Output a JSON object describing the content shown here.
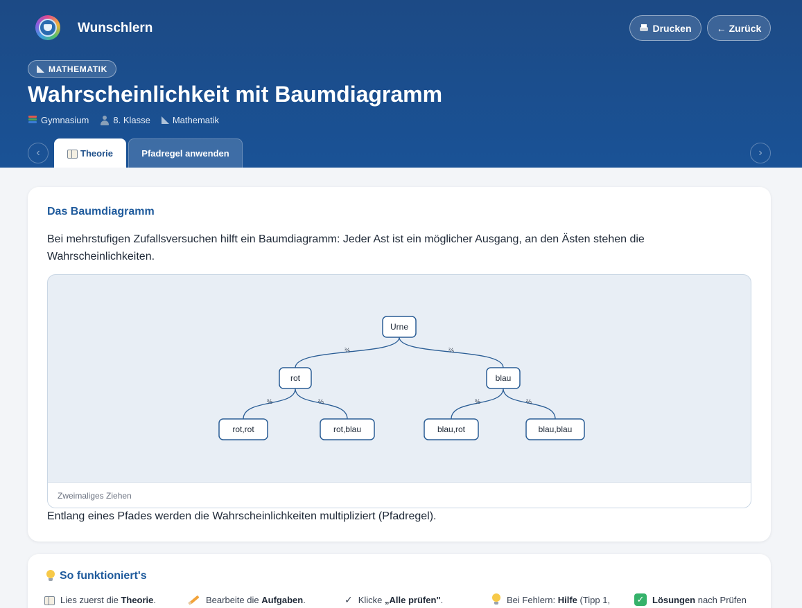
{
  "app": {
    "name": "Wunschlern"
  },
  "header": {
    "print_label": "Drucken",
    "back_label": "← Zurück",
    "subject_pill": "MATHEMATIK",
    "title": "Wahrscheinlichkeit mit Baumdiagramm",
    "meta": {
      "school": "Gymnasium",
      "grade": "8. Klasse",
      "subject": "Mathematik"
    },
    "nav_prev": "‹",
    "nav_next": "›"
  },
  "tabs": [
    {
      "label": "Theorie",
      "active": true
    },
    {
      "label": "Pfadregel anwenden",
      "active": false
    }
  ],
  "theory": {
    "heading": "Das Baumdiagramm",
    "intro": "Bei mehrstufigen Zufallsversuchen hilft ein Baumdiagramm: Jeder Ast ist ein möglicher Ausgang, an den Ästen stehen die Wahrscheinlichkeiten.",
    "diagram": {
      "root": "Urne",
      "level1": [
        {
          "label": "rot",
          "prob": "⅗"
        },
        {
          "label": "blau",
          "prob": "⅖"
        }
      ],
      "level2": [
        {
          "label": "rot,rot",
          "prob": "⅗"
        },
        {
          "label": "rot,blau",
          "prob": "⅖"
        },
        {
          "label": "blau,rot",
          "prob": "⅗"
        },
        {
          "label": "blau,blau",
          "prob": "⅖"
        }
      ],
      "caption": "Zweimaliges Ziehen"
    },
    "outro": "Entlang eines Pfades werden die Wahrscheinlichkeiten multipliziert (Pfadregel)."
  },
  "howto": {
    "heading": "So funktioniert's",
    "steps": [
      {
        "pre": "Lies zuerst die ",
        "bold": "Theorie",
        "post": "."
      },
      {
        "pre": "Bearbeite die ",
        "bold": "Aufgaben",
        "post": "."
      },
      {
        "pre": "Klicke ",
        "bold": "„Alle prüfen\"",
        "post": "."
      },
      {
        "pre": "Bei Fehlern: ",
        "bold": "Hilfe",
        "post": " (Tipp 1,"
      },
      {
        "pre": "",
        "bold": "Lösungen",
        "post": " nach Prüfen"
      }
    ]
  },
  "colors": {
    "header": "#1c4a85",
    "accent": "#1e5a9c",
    "node_border": "#2a5d95"
  }
}
